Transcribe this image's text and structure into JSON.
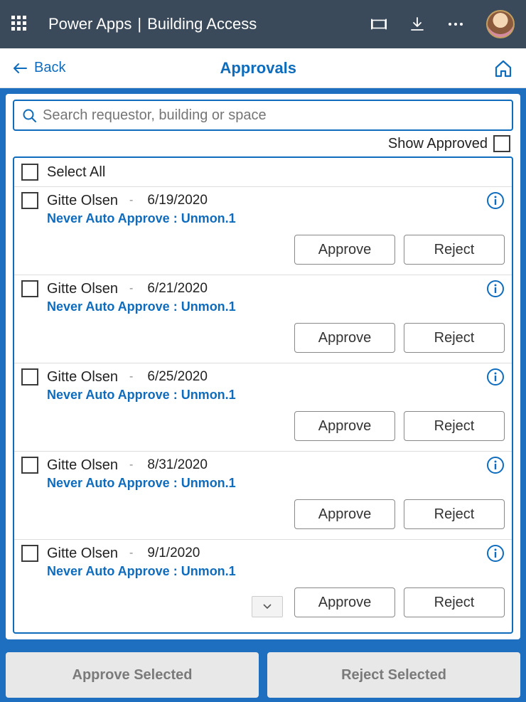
{
  "header": {
    "app_name": "Power Apps",
    "page_name": "Building Access"
  },
  "subheader": {
    "back_label": "Back",
    "title": "Approvals"
  },
  "search": {
    "placeholder": "Search requestor, building or space"
  },
  "show_approved_label": "Show Approved",
  "select_all_label": "Select All",
  "requests": [
    {
      "name": "Gitte Olsen",
      "date": "6/19/2020",
      "sub": "Never Auto Approve : Unmon.1",
      "approve": "Approve",
      "reject": "Reject"
    },
    {
      "name": "Gitte Olsen",
      "date": "6/21/2020",
      "sub": "Never Auto Approve : Unmon.1",
      "approve": "Approve",
      "reject": "Reject"
    },
    {
      "name": "Gitte Olsen",
      "date": "6/25/2020",
      "sub": "Never Auto Approve : Unmon.1",
      "approve": "Approve",
      "reject": "Reject"
    },
    {
      "name": "Gitte Olsen",
      "date": "8/31/2020",
      "sub": "Never Auto Approve : Unmon.1",
      "approve": "Approve",
      "reject": "Reject"
    },
    {
      "name": "Gitte Olsen",
      "date": "9/1/2020",
      "sub": "Never Auto Approve : Unmon.1",
      "approve": "Approve",
      "reject": "Reject"
    }
  ],
  "footer": {
    "approve_selected": "Approve Selected",
    "reject_selected": "Reject Selected"
  }
}
